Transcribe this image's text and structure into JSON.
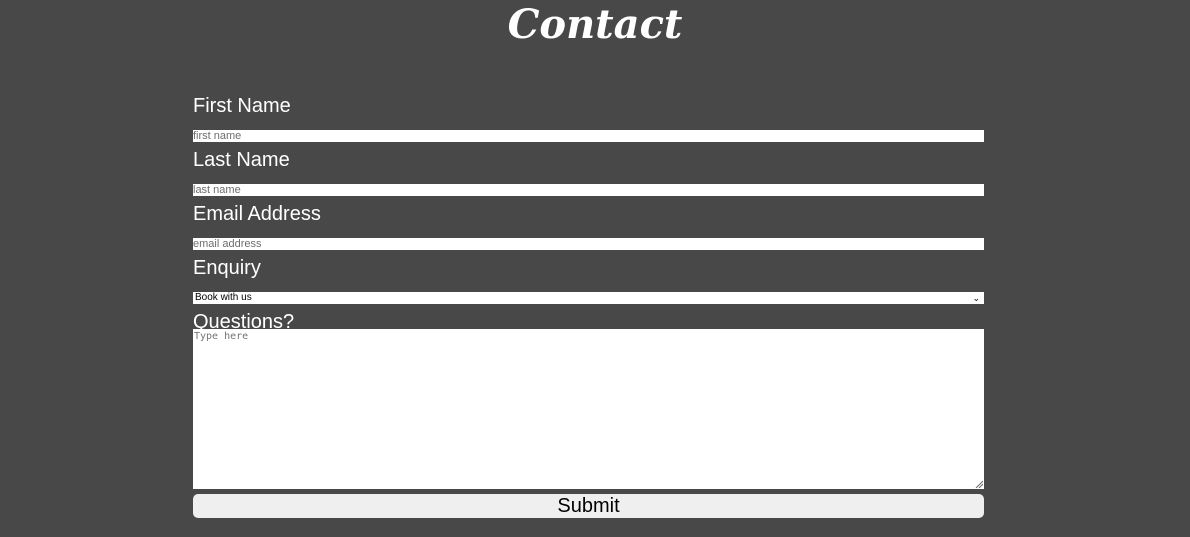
{
  "page": {
    "title": "Contact"
  },
  "form": {
    "first_name": {
      "label": "First Name",
      "placeholder": "first name",
      "value": ""
    },
    "last_name": {
      "label": "Last Name",
      "placeholder": "last name",
      "value": ""
    },
    "email": {
      "label": "Email Address",
      "placeholder": "email address",
      "value": ""
    },
    "enquiry": {
      "label": "Enquiry",
      "selected": "Book with us",
      "icon": "chevron-down-icon"
    },
    "questions": {
      "label": "Questions?",
      "placeholder": "Type here",
      "value": ""
    },
    "submit_label": "Submit"
  },
  "colors": {
    "background": "#484848",
    "text": "#ffffff",
    "field": "#ffffff",
    "button": "#efefef"
  }
}
